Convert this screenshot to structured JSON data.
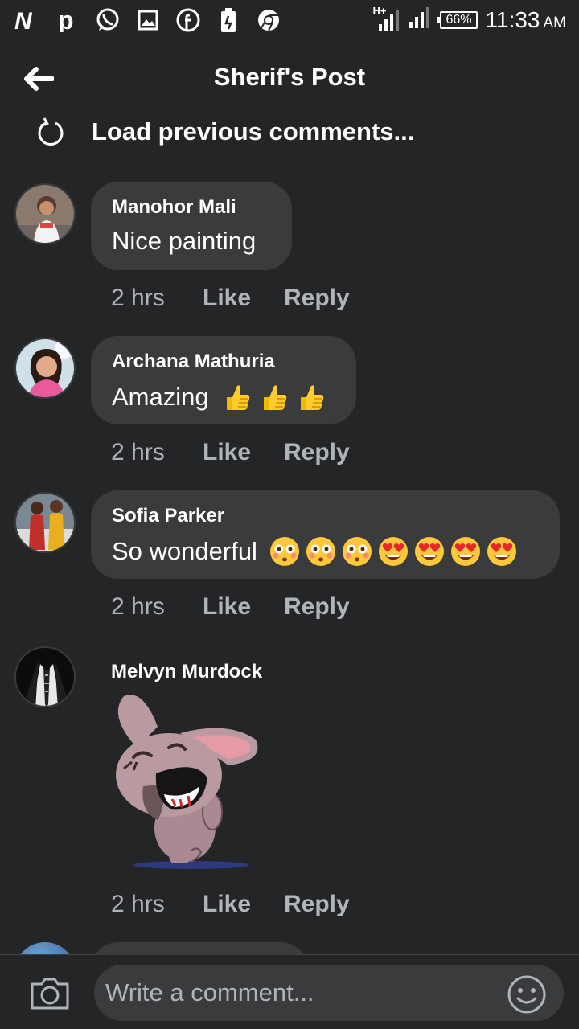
{
  "status_bar": {
    "left_icons": [
      "netflix-icon",
      "pinterest-icon",
      "whatsapp-icon",
      "gallery-icon",
      "facebook-icon",
      "battery-saver-icon",
      "chrome-icon"
    ],
    "network_type": "H+",
    "battery": "66%",
    "time": "11:33",
    "ampm": "AM"
  },
  "header": {
    "title": "Sherif's Post"
  },
  "load_previous": "Load previous comments...",
  "comments": [
    {
      "name": "Manohor Mali",
      "text": "Nice painting",
      "emojis": [],
      "time": "2 hrs",
      "like": "Like",
      "reply": "Reply"
    },
    {
      "name": "Archana Mathuria",
      "text": "Amazing",
      "emojis": [
        "thumbs-up",
        "thumbs-up",
        "thumbs-up"
      ],
      "time": "2 hrs",
      "like": "Like",
      "reply": "Reply"
    },
    {
      "name": "Sofia Parker",
      "text": "So wonderful",
      "emojis": [
        "flushed-face",
        "flushed-face",
        "flushed-face",
        "heart-eyes",
        "heart-eyes",
        "heart-eyes",
        "heart-eyes"
      ],
      "time": "2 hrs",
      "like": "Like",
      "reply": "Reply"
    },
    {
      "name": "Melvyn Murdock",
      "sticker": "laughing-bunny-sticker",
      "time": "2 hrs",
      "like": "Like",
      "reply": "Reply"
    }
  ],
  "composer": {
    "placeholder": "Write a comment..."
  },
  "colors": {
    "background": "#242526",
    "bubble": "#3a3b3c",
    "secondary_text": "#b0b3b8",
    "primary_text": "#ffffff"
  }
}
